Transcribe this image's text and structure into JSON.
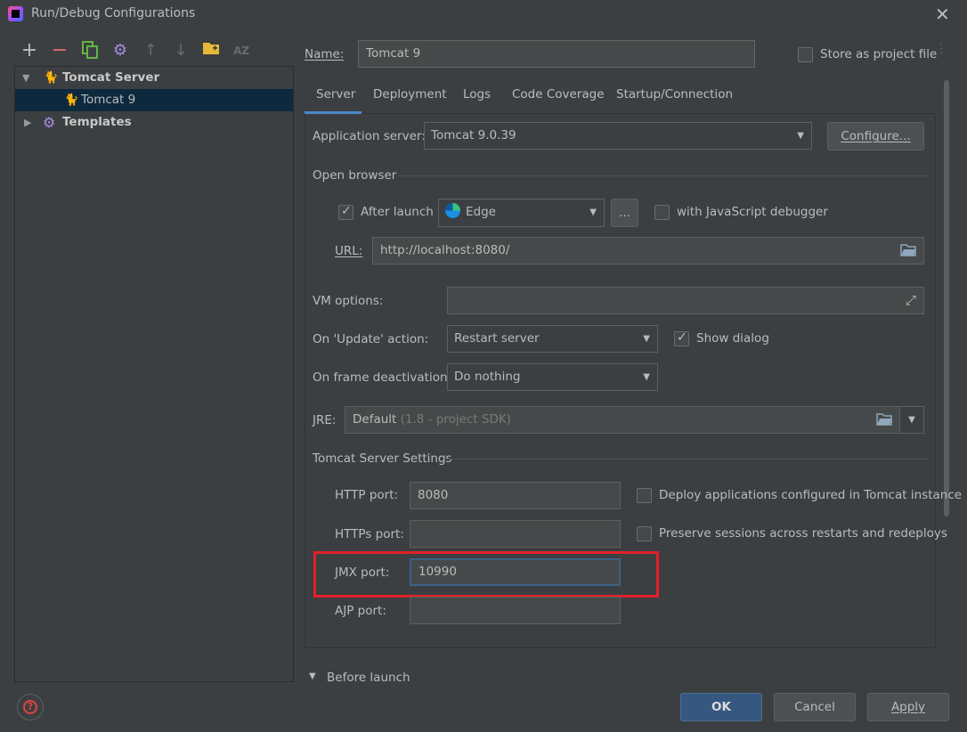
{
  "window": {
    "title": "Run/Debug Configurations",
    "close_glyph": "✕"
  },
  "toolbar": {
    "add": "+",
    "remove": "−",
    "sort": "AZ"
  },
  "tree": {
    "group_label": "Tomcat Server",
    "child_label": "Tomcat 9",
    "templates_label": "Templates"
  },
  "name": {
    "label": "Name:",
    "value": "Tomcat 9"
  },
  "store_as_project_file": {
    "label": "Store as project file",
    "checked": false
  },
  "tabs": [
    {
      "label": "Server"
    },
    {
      "label": "Deployment"
    },
    {
      "label": "Logs"
    },
    {
      "label": "Code Coverage"
    },
    {
      "label": "Startup/Connection"
    }
  ],
  "server": {
    "app_server_label": "Application server:",
    "app_server_value": "Tomcat 9.0.39",
    "configure_label": "Configure...",
    "open_browser_label": "Open browser",
    "after_launch_label": "After launch",
    "after_launch_checked": true,
    "browser_value": "Edge",
    "browse_btn": "...",
    "js_debugger_label": "with JavaScript debugger",
    "url_label": "URL:",
    "url_value": "http://localhost:8080/",
    "vm_options_label": "VM options:",
    "on_update_label": "On 'Update' action:",
    "on_update_value": "Restart server",
    "show_dialog_label": "Show dialog",
    "show_dialog_checked": true,
    "on_frame_label": "On frame deactivation:",
    "on_frame_value": "Do nothing",
    "jre_label": "JRE:",
    "jre_value": "Default",
    "jre_hint": "(1.8 - project SDK)",
    "tomcat_settings_label": "Tomcat Server Settings",
    "http_port_label": "HTTP port:",
    "http_port_value": "8080",
    "deploy_label": "Deploy applications configured in Tomcat instance",
    "https_port_label": "HTTPs port:",
    "https_port_value": "",
    "preserve_label": "Preserve sessions across restarts and redeploys",
    "jmx_port_label": "JMX port:",
    "jmx_port_value": "10990",
    "ajp_port_label": "AJP port:",
    "ajp_port_value": ""
  },
  "before_launch_label": "Before launch",
  "buttons": {
    "ok": "OK",
    "cancel": "Cancel",
    "apply": "Apply",
    "help": "?"
  }
}
